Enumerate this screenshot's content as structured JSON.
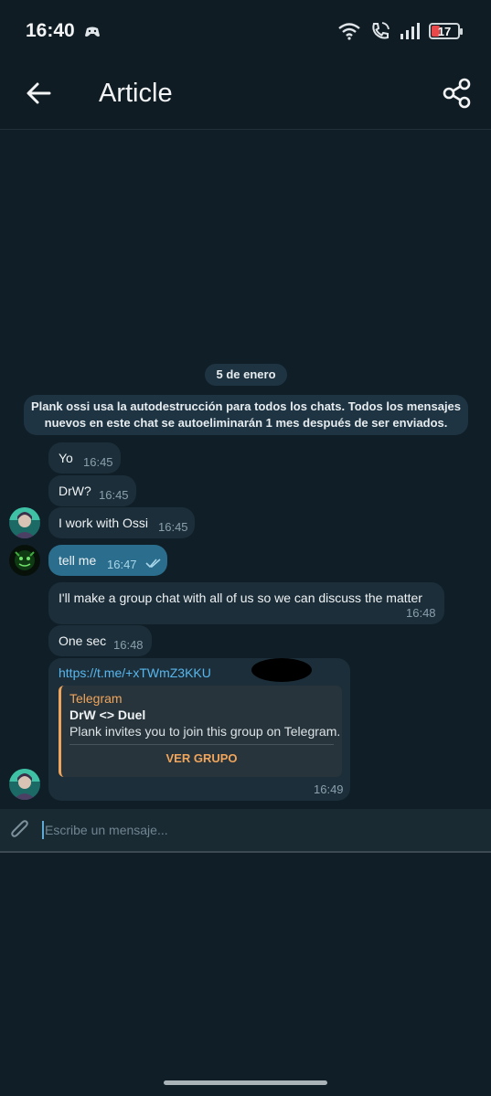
{
  "status": {
    "time": "16:40",
    "battery": "17"
  },
  "appbar": {
    "title": "Article"
  },
  "chat": {
    "date": "5 de enero",
    "service_line1": "Plank ossi usa la autodestrucción para todos los chats. Todos los mensajes",
    "service_line2": "nuevos en este chat se autoeliminarán 1 mes después de ser enviados.",
    "messages": [
      {
        "text": "Yo",
        "time": "16:45"
      },
      {
        "text": "DrW?",
        "time": "16:45"
      },
      {
        "text": "I work with Ossi",
        "time": "16:45"
      },
      {
        "text": "tell me",
        "time": "16:47"
      },
      {
        "text": "I'll make a group chat with all of us so we can discuss the matter",
        "time": "16:48"
      },
      {
        "text": "One sec",
        "time": "16:48"
      }
    ],
    "link_message": {
      "url": "https://t.me/+xTWmZ3KKU",
      "time": "16:49",
      "preview": {
        "site": "Telegram",
        "title": "DrW <> Duel",
        "description": "Plank invites you to join this group on Telegram.",
        "button": "VER GRUPO"
      }
    }
  },
  "composer": {
    "placeholder": "Escribe un mensaje..."
  },
  "colors": {
    "accent": "#58b7ee",
    "preview_accent": "#f0a55c",
    "outgoing": "#2a6d8c",
    "incoming": "#1c2e39"
  }
}
